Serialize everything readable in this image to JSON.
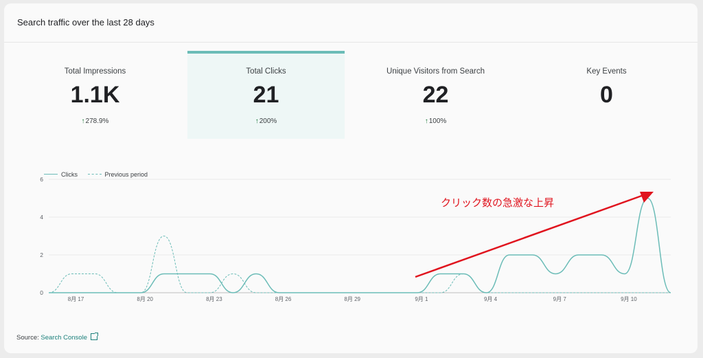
{
  "header": {
    "title": "Search traffic over the last 28 days"
  },
  "kpis": [
    {
      "label": "Total Impressions",
      "value": "1.1K",
      "change": "278.9%",
      "selected": false
    },
    {
      "label": "Total Clicks",
      "value": "21",
      "change": "200%",
      "selected": true
    },
    {
      "label": "Unique Visitors from Search",
      "value": "22",
      "change": "100%",
      "selected": false
    },
    {
      "label": "Key Events",
      "value": "0",
      "change": "",
      "selected": false
    }
  ],
  "legend": {
    "current": "Clicks",
    "previous": "Previous period"
  },
  "annotation": {
    "text": "クリック数の急激な上昇"
  },
  "source": {
    "prefix": "Source:",
    "link": "Search Console"
  },
  "colors": {
    "accent": "#6bbcb7",
    "annotation": "#e0141e",
    "trend_up": "#137333"
  },
  "chart_data": {
    "type": "line",
    "x": [
      "8月 16",
      "8月 17",
      "8月 18",
      "8月 19",
      "8月 20",
      "8月 21",
      "8月 22",
      "8月 23",
      "8月 24",
      "8月 25",
      "8月 26",
      "8月 27",
      "8月 28",
      "8月 29",
      "8月 30",
      "8月 31",
      "9月 1",
      "9月 2",
      "9月 3",
      "9月 4",
      "9月 5",
      "9月 6",
      "9月 7",
      "9月 8",
      "9月 9",
      "9月 10",
      "9月 11",
      "9月 12"
    ],
    "x_tick_labels": [
      "8月 17",
      "8月 20",
      "8月 23",
      "8月 26",
      "8月 29",
      "9月 1",
      "9月 4",
      "9月 7",
      "9月 10"
    ],
    "y_ticks": [
      0,
      2,
      4,
      6
    ],
    "ylim": [
      0,
      6
    ],
    "series": [
      {
        "name": "Clicks",
        "style": "solid",
        "values": [
          0,
          0,
          0,
          0,
          0,
          1,
          1,
          1,
          0,
          1,
          0,
          0,
          0,
          0,
          0,
          0,
          0,
          1,
          1,
          0,
          2,
          2,
          1,
          2,
          2,
          1,
          5,
          0
        ]
      },
      {
        "name": "Previous period",
        "style": "dashed",
        "values": [
          0,
          1,
          1,
          0,
          0,
          3,
          0,
          0,
          1,
          0,
          0,
          0,
          0,
          0,
          0,
          0,
          0,
          0,
          1,
          0,
          0,
          0,
          0,
          0,
          0,
          0,
          0,
          0
        ]
      }
    ],
    "grid": true,
    "legend_position": "top-left"
  }
}
